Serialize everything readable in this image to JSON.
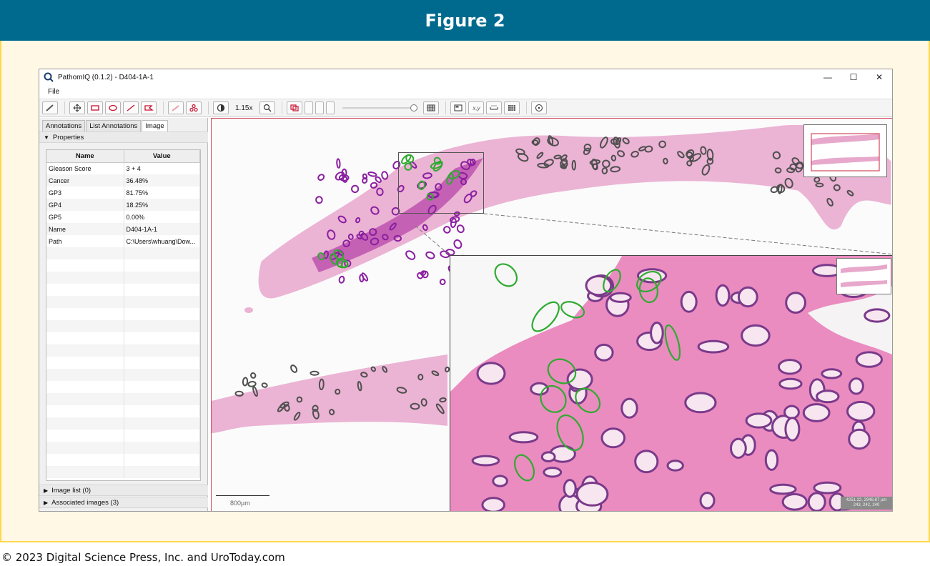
{
  "figure": {
    "title": "Figure 2",
    "copyright": "© 2023 Digital Science Press, Inc. and UroToday.com"
  },
  "window": {
    "title": "PathomIQ (0.1.2) - D404-1A-1",
    "controls": {
      "minimize": "—",
      "maximize": "☐",
      "close": "✕"
    }
  },
  "menu": {
    "file": "File"
  },
  "toolbar": {
    "zoom_level": "1.15x",
    "coord_btn": "x,y"
  },
  "left_panel": {
    "tabs": [
      "Annotations",
      "List Annotations",
      "Image"
    ],
    "properties_header": "Properties",
    "table": {
      "headers": [
        "Name",
        "Value"
      ],
      "rows": [
        [
          "Gleason Score",
          "3 + 4"
        ],
        [
          "Cancer",
          "36.48%"
        ],
        [
          "GP3",
          "81.75%"
        ],
        [
          "GP4",
          "18.25%"
        ],
        [
          "GP5",
          "0.00%"
        ],
        [
          "Name",
          "D404-1A-1"
        ],
        [
          "Path",
          "C:\\Users\\whuang\\Dow..."
        ]
      ]
    },
    "image_list": "Image list (0)",
    "associated_images": "Associated images (3)"
  },
  "viewer": {
    "scale_label": "800µm",
    "coord_line1": "4251.22, 2948.87 µm",
    "coord_line2": "243, 242, 240"
  },
  "colors": {
    "header_bg": "#006a8e",
    "body_bg": "#fff8e4",
    "border_yellow": "#ffd84a",
    "tissue_pink": "#e88bbf",
    "gp3_annotation": "#8a1fa0",
    "gp4_annotation": "#2faa2f",
    "benign_outline": "#555555",
    "viewer_frame": "#d24a5c"
  }
}
